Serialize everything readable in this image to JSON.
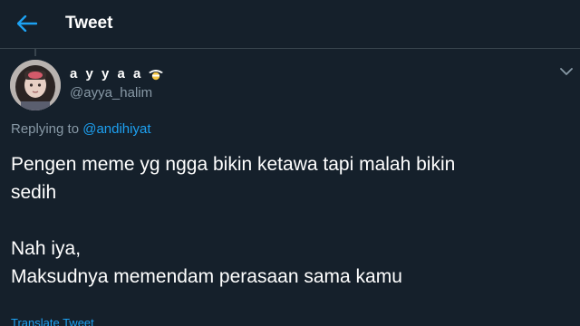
{
  "header": {
    "title": "Tweet",
    "back_icon": "arrow-left-icon",
    "accent_color": "#1da1f2"
  },
  "author": {
    "display_name": "a y y a a",
    "badge_icon": "emoji-badge-icon",
    "handle": "@ayya_halim"
  },
  "reply": {
    "prefix": "Replying to ",
    "mention": "@andihiyat"
  },
  "tweet": {
    "line1": "Pengen meme yg ngga bikin ketawa tapi malah bikin",
    "line2": "sedih",
    "line3": "Nah iya,",
    "line4": "Maksudnya memendam perasaan sama kamu"
  },
  "translate_label": "Translate Tweet",
  "colors": {
    "background": "#15202b",
    "secondary_text": "#8899a6",
    "divider": "#38444d"
  }
}
